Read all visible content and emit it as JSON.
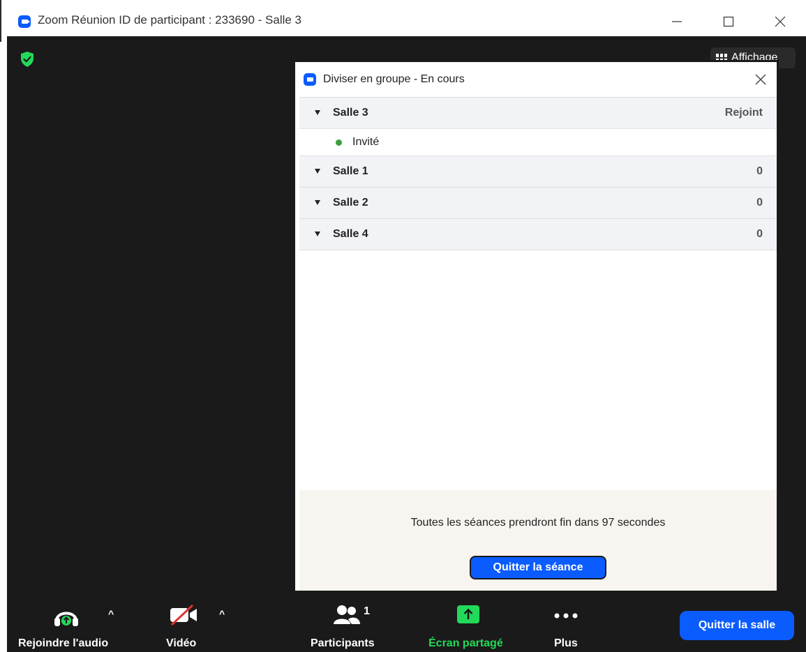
{
  "window": {
    "title": "Zoom Réunion ID de participant : 233690 - Salle 3",
    "minimize_icon": "minimize-icon",
    "maximize_icon": "maximize-icon",
    "close_icon": "close-icon"
  },
  "meeting": {
    "view_label": "Affichage",
    "security_icon": "shield-check-icon"
  },
  "dialog": {
    "title": "Diviser en groupe - En cours",
    "rooms": [
      {
        "name": "Salle 3",
        "status": "Rejoint",
        "members": [
          "Invité"
        ]
      },
      {
        "name": "Salle 1",
        "status": "0",
        "members": []
      },
      {
        "name": "Salle 2",
        "status": "0",
        "members": []
      },
      {
        "name": "Salle 4",
        "status": "0",
        "members": []
      }
    ],
    "countdown_message": "Toutes les séances prendront fin dans 97 secondes",
    "leave_session_label": "Quitter la séance"
  },
  "toolbar": {
    "audio_label": "Rejoindre l'audio",
    "video_label": "Vidéo",
    "participants_label": "Participants",
    "participants_count": "1",
    "share_label": "Écran partagé",
    "more_label": "Plus",
    "leave_room_label": "Quitter la salle"
  },
  "colors": {
    "accent": "#0b5cff",
    "share_green": "#23d959",
    "status_green": "#3c9e3c",
    "meeting_bg": "#1a1a1a"
  }
}
